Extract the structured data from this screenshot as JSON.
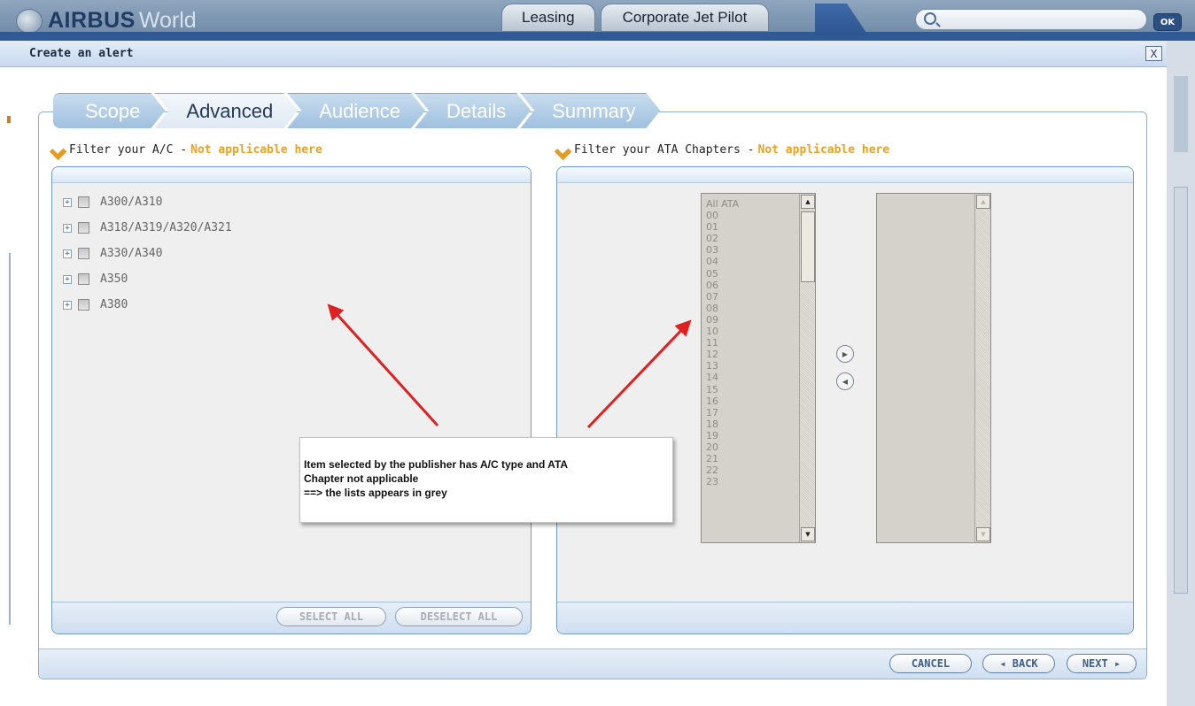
{
  "header": {
    "logo_brand": "AIRBUS",
    "logo_suffix": "World",
    "tabs": [
      {
        "label": "Leasing"
      },
      {
        "label": "Corporate Jet Pilot"
      }
    ],
    "search": {
      "placeholder": ""
    },
    "ok_label": "OK"
  },
  "dialog": {
    "title": "Create an alert",
    "close_label": "X"
  },
  "wizard": {
    "steps": [
      {
        "label": "Scope",
        "active": false
      },
      {
        "label": "Advanced",
        "active": true
      },
      {
        "label": "Audience",
        "active": false
      },
      {
        "label": "Details",
        "active": false
      },
      {
        "label": "Summary",
        "active": false
      }
    ]
  },
  "ac_filter": {
    "label": "Filter your A/C - ",
    "status": "Not applicable here",
    "items": [
      {
        "label": "A300/A310"
      },
      {
        "label": "A318/A319/A320/A321"
      },
      {
        "label": "A330/A340"
      },
      {
        "label": "A350"
      },
      {
        "label": "A380"
      }
    ],
    "select_all_label": "SELECT ALL",
    "deselect_all_label": "DESELECT ALL"
  },
  "ata_filter": {
    "label": "Filter your ATA Chapters - ",
    "status": "Not applicable here",
    "available": [
      "All ATA",
      "00",
      "01",
      "02",
      "03",
      "04",
      "05",
      "06",
      "07",
      "08",
      "09",
      "10",
      "11",
      "12",
      "13",
      "14",
      "15",
      "16",
      "17",
      "18",
      "19",
      "20",
      "21",
      "22",
      "23"
    ],
    "selected": []
  },
  "callout": {
    "line1": "Item selected by the publisher has A/C type and ATA",
    "line2": "Chapter not applicable",
    "line3": "==> the lists appears in grey"
  },
  "footer": {
    "cancel_label": "CANCEL",
    "back_label": "◂ BACK",
    "next_label": "NEXT ▸"
  },
  "colors": {
    "accent": "#f0a020",
    "annotation_arrow": "#e02020",
    "header_blue": "#2f5a96"
  }
}
